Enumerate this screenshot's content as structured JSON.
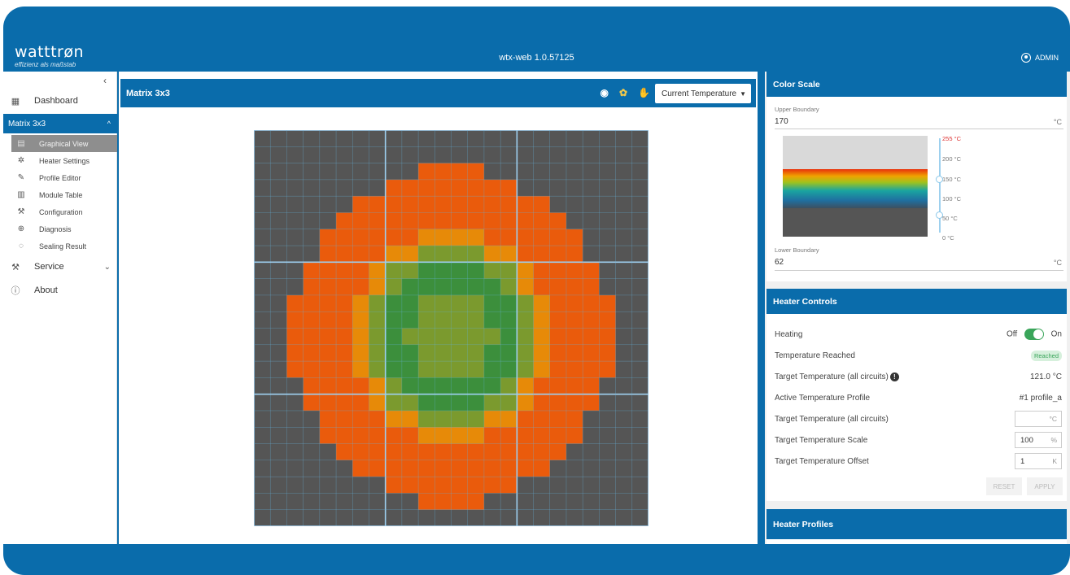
{
  "header": {
    "logo_main": "watttrøn",
    "logo_sub": "effizienz als maßstab",
    "app_version": "wtx-web 1.0.57125",
    "user": "ADMIN"
  },
  "sidebar": {
    "collapse": "‹",
    "dashboard": "Dashboard",
    "section": "Matrix 3x3",
    "items": [
      {
        "label": "Graphical View",
        "icon": "grid-icon",
        "active": true
      },
      {
        "label": "Heater Settings",
        "icon": "gear-icon"
      },
      {
        "label": "Profile Editor",
        "icon": "pencil-icon"
      },
      {
        "label": "Module Table",
        "icon": "table-icon"
      },
      {
        "label": "Configuration",
        "icon": "wrench-icon"
      },
      {
        "label": "Diagnosis",
        "icon": "magnifier-icon"
      },
      {
        "label": "Sealing Result",
        "icon": "seal-icon"
      }
    ],
    "service": "Service",
    "about": "About"
  },
  "main": {
    "title": "Matrix 3x3",
    "view_select": "Current Temperature"
  },
  "heatmap": {
    "colors": {
      "off": "#555555",
      "orange": "#ea5b0c",
      "amber": "#e78a08",
      "olive": "#7b9a2e",
      "green": "#3c8f3c",
      "grid": "#64b5e0",
      "module": "#9ecff0"
    },
    "rows": [
      "000000000000000000000000",
      "000000000000000000000000",
      "000000000011110000000000",
      "000000001111111100000000",
      "000000111111111111000000",
      "000001111111111111100000",
      "000011111122221111110000",
      "000011112233332211110000",
      "000111123344443321111000",
      "000111123444444321111000",
      "001111234433334432111100",
      "001111234433334432111100",
      "001111234333333432111100",
      "001111234433334432111100",
      "001111234433334432111100",
      "000111123444444321111000",
      "000111123344443321111000",
      "000011112233332211110000",
      "000011111122221111110000",
      "000001111111111111100000",
      "000000111111111111000000",
      "000000001111111100000000",
      "000000000011110000000000",
      "000000000000000000000000"
    ]
  },
  "color_scale": {
    "title": "Color Scale",
    "upper_label": "Upper Boundary",
    "upper_value": "170",
    "lower_label": "Lower Boundary",
    "lower_value": "62",
    "unit": "°C",
    "ticks": [
      "255 °C",
      "200 °C",
      "150 °C",
      "100 °C",
      "50 °C",
      "0 °C"
    ]
  },
  "heater_controls": {
    "title": "Heater Controls",
    "heating_label": "Heating",
    "off": "Off",
    "on": "On",
    "reached_label": "Temperature Reached",
    "reached_badge": "Reached",
    "target_all_label": "Target Temperature (all circuits)",
    "target_all_value": "121.0 °C",
    "profile_label": "Active Temperature Profile",
    "profile_value": "#1 profile_a",
    "target_input_label": "Target Temperature (all circuits)",
    "target_input_value": "",
    "target_input_unit": "°C",
    "scale_label": "Target Temperature Scale",
    "scale_value": "100",
    "scale_unit": "%",
    "offset_label": "Target Temperature Offset",
    "offset_value": "1",
    "offset_unit": "K",
    "reset": "RESET",
    "apply": "APPLY"
  },
  "heater_profiles": {
    "title": "Heater Profiles"
  }
}
